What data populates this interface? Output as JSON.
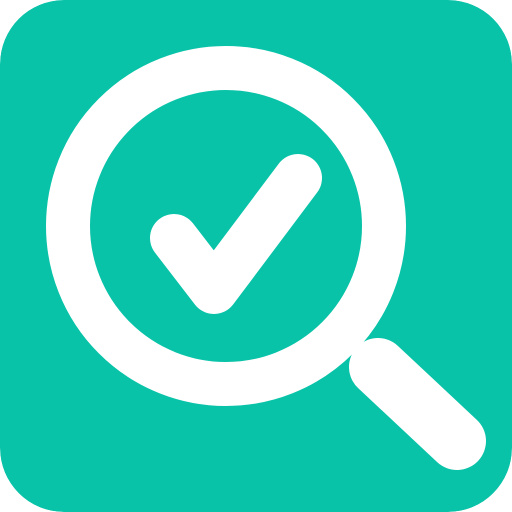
{
  "icon": {
    "name": "magnifier-check-icon",
    "background_color": "#08C3A8",
    "foreground_color": "#FFFFFF",
    "parts": [
      "magnifying-glass",
      "checkmark"
    ]
  }
}
